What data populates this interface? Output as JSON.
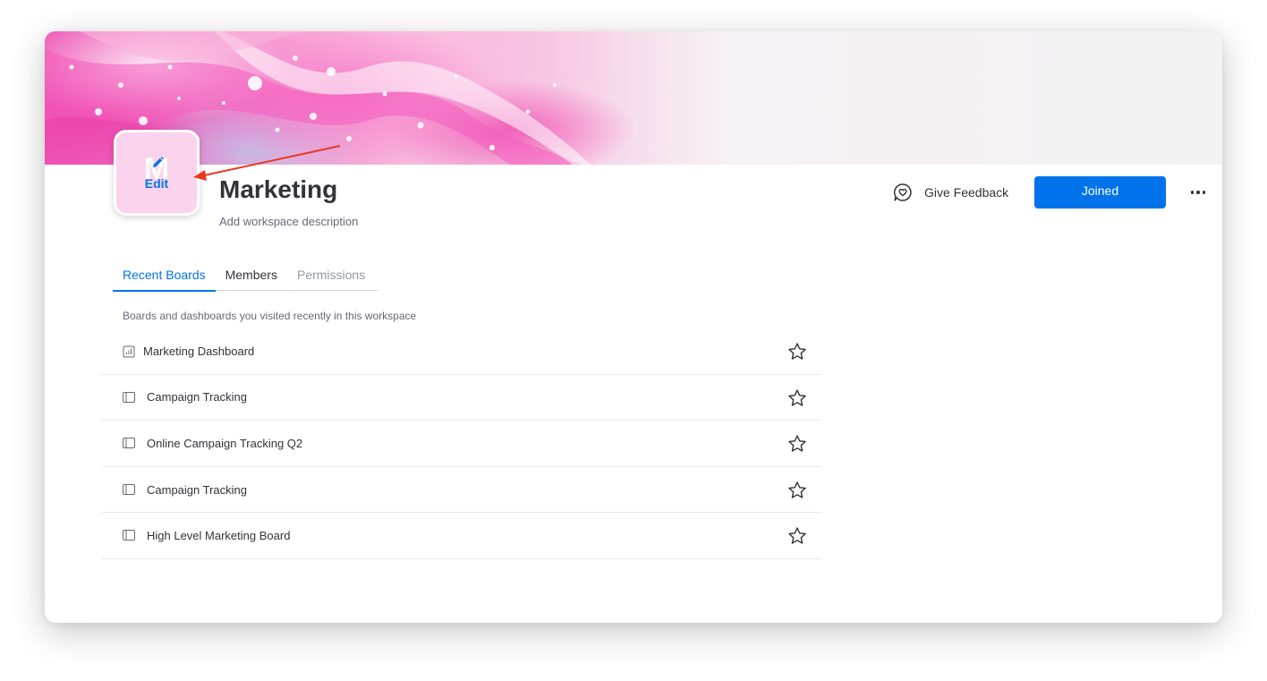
{
  "workspace": {
    "name": "Marketing",
    "description_placeholder": "Add workspace description",
    "avatar_letter": "M",
    "avatar_edit_label": "Edit",
    "avatar_color": "#fcd3ec"
  },
  "header": {
    "feedback_label": "Give Feedback",
    "joined_label": "Joined",
    "feedback_icon": "heart-chat-icon",
    "more_icon": "more-dots-icon"
  },
  "tabs": [
    {
      "label": "Recent Boards",
      "state": "active"
    },
    {
      "label": "Members",
      "state": "normal"
    },
    {
      "label": "Permissions",
      "state": "muted"
    }
  ],
  "recent": {
    "subtitle": "Boards and dashboards you visited recently in this workspace",
    "items": [
      {
        "name": "Marketing Dashboard",
        "type": "dashboard",
        "icon": "dashboard-icon"
      },
      {
        "name": "Campaign Tracking",
        "type": "board",
        "icon": "board-icon"
      },
      {
        "name": "Online Campaign Tracking Q2",
        "type": "board",
        "icon": "board-icon"
      },
      {
        "name": "Campaign Tracking",
        "type": "board",
        "icon": "board-icon"
      },
      {
        "name": "High Level Marketing Board",
        "type": "board",
        "icon": "board-icon"
      }
    ]
  },
  "colors": {
    "primary": "#0073ea",
    "annotation_arrow": "#e8391d",
    "text": "#323338",
    "secondary_text": "#676879"
  }
}
